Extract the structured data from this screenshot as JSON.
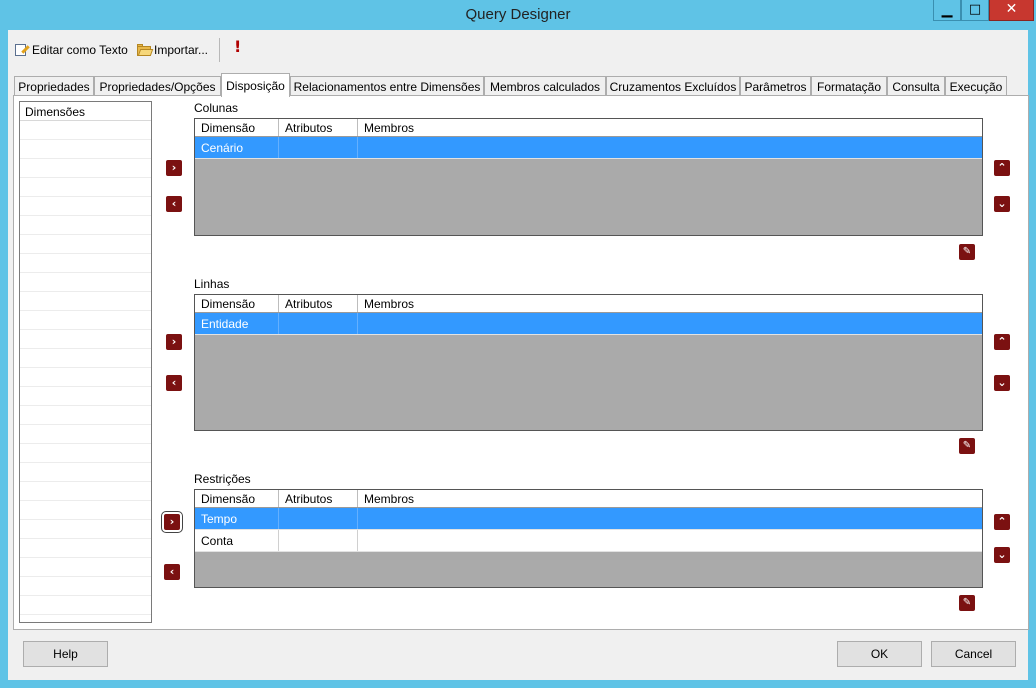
{
  "window": {
    "title": "Query Designer",
    "min_glyph": "▁",
    "max_glyph": "□",
    "close_glyph": "✕"
  },
  "toolbar": {
    "edit_text_label": "Editar como Texto",
    "import_label": "Importar...",
    "run_glyph": "!"
  },
  "tabs": [
    {
      "label": "Propriedades",
      "active": false
    },
    {
      "label": "Propriedades/Opções",
      "active": false
    },
    {
      "label": "Disposição",
      "active": true
    },
    {
      "label": "Relacionamentos entre Dimensões",
      "active": false
    },
    {
      "label": "Membros calculados",
      "active": false
    },
    {
      "label": "Cruzamentos Excluídos",
      "active": false
    },
    {
      "label": "Parâmetros",
      "active": false
    },
    {
      "label": "Formatação",
      "active": false
    },
    {
      "label": "Consulta",
      "active": false
    },
    {
      "label": "Execução",
      "active": false
    }
  ],
  "dimensions_list": {
    "header": "Dimensões"
  },
  "columns": [
    "Dimensão",
    "Atributos",
    "Membros"
  ],
  "sections": {
    "colunas": {
      "label": "Colunas",
      "rows": [
        {
          "dimension": "Cenário",
          "attributes": "",
          "members": "",
          "selected": true
        }
      ]
    },
    "linhas": {
      "label": "Linhas",
      "rows": [
        {
          "dimension": "Entidade",
          "attributes": "",
          "members": "",
          "selected": true
        }
      ]
    },
    "restricoes": {
      "label": "Restrições",
      "rows": [
        {
          "dimension": "Tempo",
          "attributes": "",
          "members": "",
          "selected": true
        },
        {
          "dimension": "Conta",
          "attributes": "",
          "members": "",
          "selected": false
        }
      ]
    }
  },
  "glyphs": {
    "move_right": "›",
    "move_left": "‹",
    "move_up": "⌃",
    "move_down": "⌄",
    "edit": "✎"
  },
  "footer": {
    "help_label": "Help",
    "ok_label": "OK",
    "cancel_label": "Cancel"
  },
  "colors": {
    "title_bar": "#5fc3e6",
    "selection": "#3399ff",
    "action_button": "#7b1111",
    "grid_empty": "#aaaaaa"
  }
}
